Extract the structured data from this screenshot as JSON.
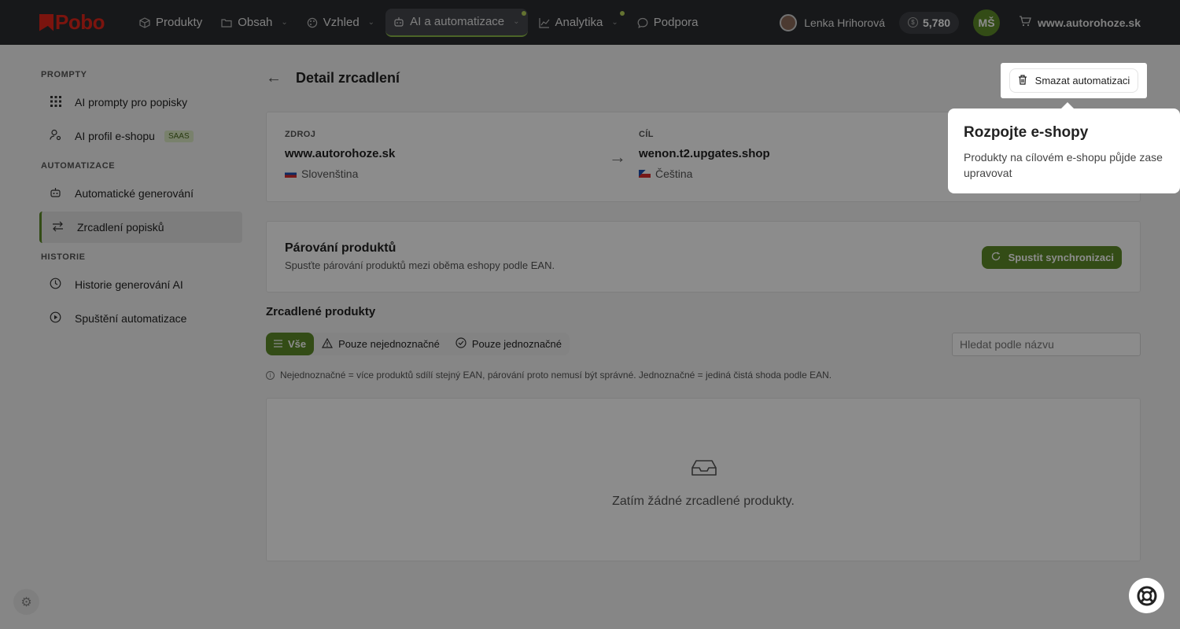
{
  "topnav": {
    "logo_text": "Pobo",
    "items": [
      {
        "label": "Produkty",
        "icon": "box-icon"
      },
      {
        "label": "Obsah",
        "icon": "folder-icon"
      },
      {
        "label": "Vzhled",
        "icon": "palette-icon"
      },
      {
        "label": "AI a automatizace",
        "icon": "robot-icon"
      },
      {
        "label": "Analytika",
        "icon": "chart-icon"
      },
      {
        "label": "Podpora",
        "icon": "chat-icon"
      }
    ],
    "user_name": "Lenka Hrihorová",
    "credits": "5,780",
    "avatar_initials": "MŠ",
    "shop": "www.autorohoze.sk"
  },
  "sidebar": {
    "sections": [
      {
        "title": "PROMPTY",
        "items": [
          {
            "label": "AI prompty pro popisky"
          },
          {
            "label": "AI profil e-shopu",
            "badge": "SAAS"
          }
        ]
      },
      {
        "title": "AUTOMATIZACE",
        "items": [
          {
            "label": "Automatické generování"
          },
          {
            "label": "Zrcadlení popisků"
          }
        ]
      },
      {
        "title": "HISTORIE",
        "items": [
          {
            "label": "Historie generování AI"
          },
          {
            "label": "Spuštění automatizace"
          }
        ]
      }
    ]
  },
  "page": {
    "title": "Detail zrcadlení",
    "delete_label": "Smazat automatizaci"
  },
  "mirror": {
    "source_label": "ZDROJ",
    "source_domain": "www.autorohoze.sk",
    "source_lang": "Slovenština",
    "target_label": "CÍL",
    "target_domain": "wenon.t2.upgates.shop",
    "target_lang": "Čeština"
  },
  "pairing": {
    "title": "Párování produktů",
    "subtitle": "Spusťte párování produktů mezi oběma eshopy podle EAN.",
    "sync_label": "Spustit synchronizaci"
  },
  "products": {
    "heading": "Zrcadlené produkty",
    "filters": [
      "Vše",
      "Pouze nejednoznačné",
      "Pouze jednoznačné"
    ],
    "search_placeholder": "Hledat podle názvu",
    "info": "Nejednoznačné = více produktů sdílí stejný EAN, párování proto nemusí být správné. Jednoznačné = jediná čistá shoda podle EAN.",
    "empty_text": "Zatím žádné zrcadlené produkty."
  },
  "popover": {
    "title": "Rozpojte e-shopy",
    "body": "Produkty na cílovém e-shopu půjde zase upravovat"
  },
  "colors": {
    "accent": "#5d8a28",
    "topbar": "#2b2d31",
    "brand": "#e1251b"
  }
}
